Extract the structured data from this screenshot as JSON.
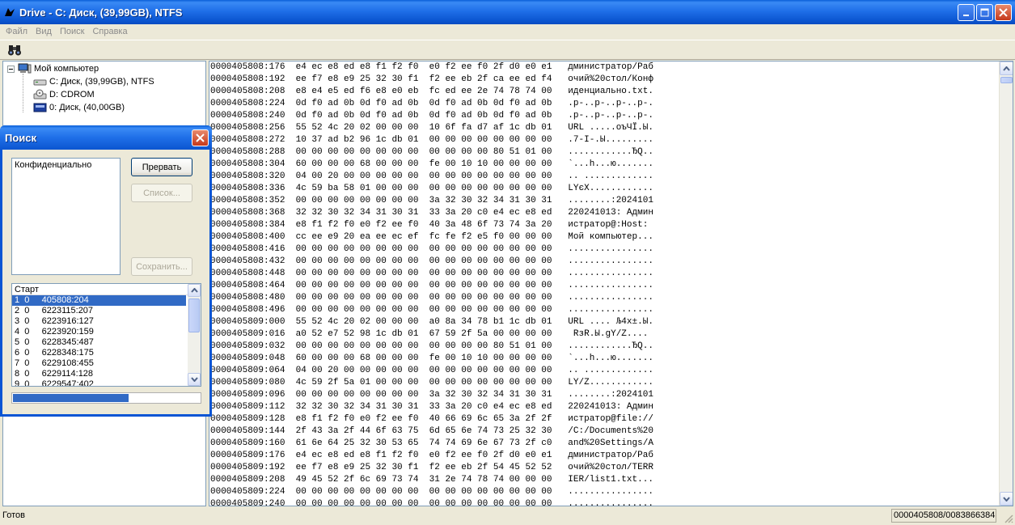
{
  "window": {
    "title": "Drive - C: Диск, (39,99GB), NTFS"
  },
  "menu": [
    "Файл",
    "Вид",
    "Поиск",
    "Справка"
  ],
  "tree": {
    "root": "Мой компьютер",
    "items": [
      "C: Диск, (39,99GB), NTFS",
      "D: CDROM",
      "0: Диск, (40,00GB)"
    ]
  },
  "hex_rows": [
    {
      "offset": "0000405808:176",
      "hex": "e4 ec e8 ed e8 f1 f2 f0  e0 f2 ee f0 2f d0 e0 e1",
      "ascii": "дминистратор/Раб"
    },
    {
      "offset": "0000405808:192",
      "hex": "ee f7 e8 e9 25 32 30 f1  f2 ee eb 2f ca ee ed f4",
      "ascii": "очий%20стол/Конф"
    },
    {
      "offset": "0000405808:208",
      "hex": "e8 e4 e5 ed f6 e8 e0 eb  fc ed ee 2e 74 78 74 00",
      "ascii": "иденциально.txt."
    },
    {
      "offset": "0000405808:224",
      "hex": "0d f0 ad 0b 0d f0 ad 0b  0d f0 ad 0b 0d f0 ad 0b",
      "ascii": ".р-..р-..р-..р-."
    },
    {
      "offset": "0000405808:240",
      "hex": "0d f0 ad 0b 0d f0 ad 0b  0d f0 ad 0b 0d f0 ad 0b",
      "ascii": ".р-..р-..р-..р-."
    },
    {
      "offset": "0000405808:256",
      "hex": "55 52 4c 20 02 00 00 00  10 6f fa d7 af 1c db 01",
      "ascii": "URL .....оъЧЇ.Ы."
    },
    {
      "offset": "0000405808:272",
      "hex": "10 37 ad b2 96 1c db 01  00 00 00 00 00 00 00 00",
      "ascii": ".7-І-.Ы........."
    },
    {
      "offset": "0000405808:288",
      "hex": "00 00 00 00 00 00 00 00  00 00 00 00 80 51 01 00",
      "ascii": "............ЂQ.."
    },
    {
      "offset": "0000405808:304",
      "hex": "60 00 00 00 68 00 00 00  fe 00 10 10 00 00 00 00",
      "ascii": "`...h...ю......."
    },
    {
      "offset": "0000405808:320",
      "hex": "04 00 20 00 00 00 00 00  00 00 00 00 00 00 00 00",
      "ascii": ".. ............."
    },
    {
      "offset": "0000405808:336",
      "hex": "4c 59 ba 58 01 00 00 00  00 00 00 00 00 00 00 00",
      "ascii": "LYєX............"
    },
    {
      "offset": "0000405808:352",
      "hex": "00 00 00 00 00 00 00 00  3a 32 30 32 34 31 30 31",
      "ascii": "........:2024101"
    },
    {
      "offset": "0000405808:368",
      "hex": "32 32 30 32 34 31 30 31  33 3a 20 c0 e4 ec e8 ed",
      "ascii": "220241013: Админ"
    },
    {
      "offset": "0000405808:384",
      "hex": "e8 f1 f2 f0 e0 f2 ee f0  40 3a 48 6f 73 74 3a 20",
      "ascii": "истратор@:Host: "
    },
    {
      "offset": "0000405808:400",
      "hex": "cc ee e9 20 ea ee ec ef  fc fe f2 e5 f0 00 00 00",
      "ascii": "Мой компьютер..."
    },
    {
      "offset": "0000405808:416",
      "hex": "00 00 00 00 00 00 00 00  00 00 00 00 00 00 00 00",
      "ascii": "................"
    },
    {
      "offset": "0000405808:432",
      "hex": "00 00 00 00 00 00 00 00  00 00 00 00 00 00 00 00",
      "ascii": "................"
    },
    {
      "offset": "0000405808:448",
      "hex": "00 00 00 00 00 00 00 00  00 00 00 00 00 00 00 00",
      "ascii": "................"
    },
    {
      "offset": "0000405808:464",
      "hex": "00 00 00 00 00 00 00 00  00 00 00 00 00 00 00 00",
      "ascii": "................"
    },
    {
      "offset": "0000405808:480",
      "hex": "00 00 00 00 00 00 00 00  00 00 00 00 00 00 00 00",
      "ascii": "................"
    },
    {
      "offset": "0000405808:496",
      "hex": "00 00 00 00 00 00 00 00  00 00 00 00 00 00 00 00",
      "ascii": "................"
    },
    {
      "offset": "0000405809:000",
      "hex": "55 52 4c 20 02 00 00 00  a0 8a 34 78 b1 1c db 01",
      "ascii": "URL .... Љ4x±.Ы."
    },
    {
      "offset": "0000405809:016",
      "hex": "a0 52 e7 52 98 1c db 01  67 59 2f 5a 00 00 00 00",
      "ascii": " RзR.Ы.gY/Z...."
    },
    {
      "offset": "0000405809:032",
      "hex": "00 00 00 00 00 00 00 00  00 00 00 00 80 51 01 00",
      "ascii": "............ЂQ.."
    },
    {
      "offset": "0000405809:048",
      "hex": "60 00 00 00 68 00 00 00  fe 00 10 10 00 00 00 00",
      "ascii": "`...h...ю......."
    },
    {
      "offset": "0000405809:064",
      "hex": "04 00 20 00 00 00 00 00  00 00 00 00 00 00 00 00",
      "ascii": ".. ............."
    },
    {
      "offset": "0000405809:080",
      "hex": "4c 59 2f 5a 01 00 00 00  00 00 00 00 00 00 00 00",
      "ascii": "LY/Z............"
    },
    {
      "offset": "0000405809:096",
      "hex": "00 00 00 00 00 00 00 00  3a 32 30 32 34 31 30 31",
      "ascii": "........:2024101"
    },
    {
      "offset": "0000405809:112",
      "hex": "32 32 30 32 34 31 30 31  33 3a 20 c0 e4 ec e8 ed",
      "ascii": "220241013: Админ"
    },
    {
      "offset": "0000405809:128",
      "hex": "e8 f1 f2 f0 e0 f2 ee f0  40 66 69 6c 65 3a 2f 2f",
      "ascii": "истратор@file://"
    },
    {
      "offset": "0000405809:144",
      "hex": "2f 43 3a 2f 44 6f 63 75  6d 65 6e 74 73 25 32 30",
      "ascii": "/C:/Documents%20"
    },
    {
      "offset": "0000405809:160",
      "hex": "61 6e 64 25 32 30 53 65  74 74 69 6e 67 73 2f c0",
      "ascii": "and%20Settings/А"
    },
    {
      "offset": "0000405809:176",
      "hex": "e4 ec e8 ed e8 f1 f2 f0  e0 f2 ee f0 2f d0 e0 e1",
      "ascii": "дминистратор/Раб"
    },
    {
      "offset": "0000405809:192",
      "hex": "ee f7 e8 e9 25 32 30 f1  f2 ee eb 2f 54 45 52 52",
      "ascii": "очий%20стол/TERR"
    },
    {
      "offset": "0000405809:208",
      "hex": "49 45 52 2f 6c 69 73 74  31 2e 74 78 74 00 00 00",
      "ascii": "IER/list1.txt..."
    },
    {
      "offset": "0000405809:224",
      "hex": "00 00 00 00 00 00 00 00  00 00 00 00 00 00 00 00",
      "ascii": "................"
    },
    {
      "offset": "0000405809:240",
      "hex": "00 00 00 00 00 00 00 00  00 00 00 00 00 00 00 00",
      "ascii": "................"
    }
  ],
  "search_dialog": {
    "title": "Поиск",
    "query": "Конфиденциально",
    "buttons": {
      "stop": "Прервать",
      "list": "Список...",
      "save": "Сохранить..."
    },
    "results_header": "Старт",
    "results": [
      "1  0     405808:204",
      "2  0     6223115:207",
      "3  0     6223916:127",
      "4  0     6223920:159",
      "5  0     6228345:487",
      "6  0     6228348:175",
      "7  0     6229108:455",
      "8  0     6229114:128",
      "9  0     6229547:402"
    ],
    "progress": 0.62
  },
  "status": {
    "text": "Готов",
    "offset": "0000405808/0083866384"
  },
  "colors": {
    "titlebar": "#0a5fd8",
    "selection": "#316ac5",
    "face": "#ece9d8"
  }
}
